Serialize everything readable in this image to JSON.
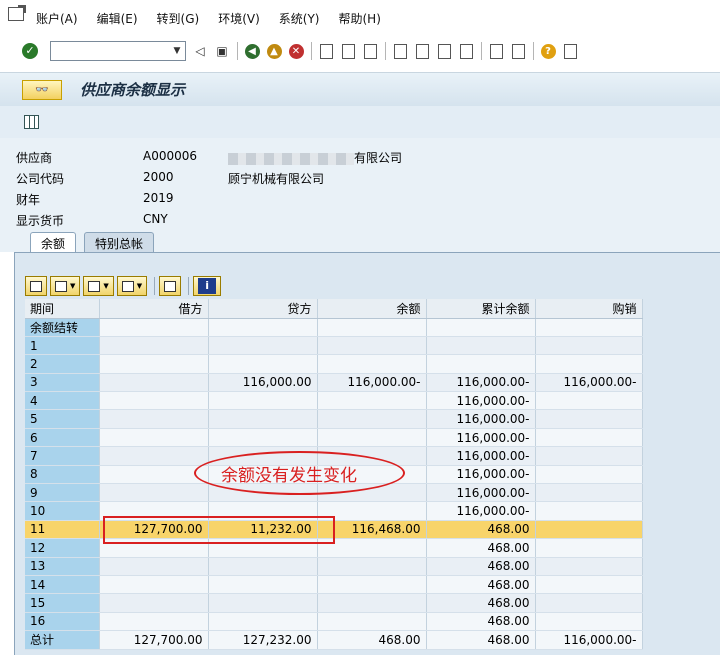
{
  "menu": [
    "账户(A)",
    "编辑(E)",
    "转到(G)",
    "环境(V)",
    "系统(Y)",
    "帮助(H)"
  ],
  "title": "供应商余额显示",
  "header": {
    "vendor": {
      "label": "供应商",
      "value": "A000006",
      "desc_suffix": "有限公司"
    },
    "company": {
      "label": "公司代码",
      "value": "2000",
      "desc": "顾宁机械有限公司"
    },
    "year": {
      "label": "财年",
      "value": "2019"
    },
    "currency": {
      "label": "显示货币",
      "value": "CNY"
    }
  },
  "tabs": [
    "余额",
    "特别总帐"
  ],
  "table": {
    "columns": [
      "期间",
      "借方",
      "贷方",
      "余额",
      "累计余额",
      "购销"
    ],
    "rows": [
      [
        "余额结转",
        "",
        "",
        "",
        "",
        ""
      ],
      [
        "1",
        "",
        "",
        "",
        "",
        ""
      ],
      [
        "2",
        "",
        "",
        "",
        "",
        ""
      ],
      [
        "3",
        "",
        "116,000.00",
        "116,000.00-",
        "116,000.00-",
        "116,000.00-"
      ],
      [
        "4",
        "",
        "",
        "",
        "116,000.00-",
        ""
      ],
      [
        "5",
        "",
        "",
        "",
        "116,000.00-",
        ""
      ],
      [
        "6",
        "",
        "",
        "",
        "116,000.00-",
        ""
      ],
      [
        "7",
        "",
        "",
        "",
        "116,000.00-",
        ""
      ],
      [
        "8",
        "",
        "",
        "",
        "116,000.00-",
        ""
      ],
      [
        "9",
        "",
        "",
        "",
        "116,000.00-",
        ""
      ],
      [
        "10",
        "",
        "",
        "",
        "116,000.00-",
        ""
      ],
      [
        "11",
        "127,700.00",
        "11,232.00",
        "116,468.00",
        "468.00",
        ""
      ],
      [
        "12",
        "",
        "",
        "",
        "468.00",
        ""
      ],
      [
        "13",
        "",
        "",
        "",
        "468.00",
        ""
      ],
      [
        "14",
        "",
        "",
        "",
        "468.00",
        ""
      ],
      [
        "15",
        "",
        "",
        "",
        "468.00",
        ""
      ],
      [
        "16",
        "",
        "",
        "",
        "468.00",
        ""
      ],
      [
        "总计",
        "127,700.00",
        "127,232.00",
        "468.00",
        "468.00",
        "116,000.00-"
      ]
    ],
    "selected_row": 11
  },
  "annotation": "余额没有发生变化"
}
